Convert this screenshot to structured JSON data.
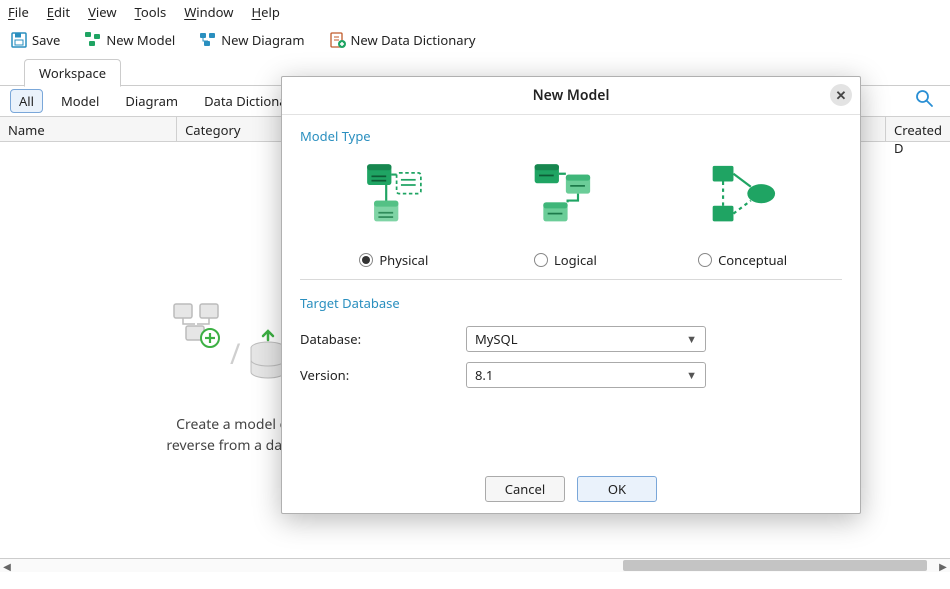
{
  "menubar": {
    "file": "File",
    "edit": "Edit",
    "view": "View",
    "tools": "Tools",
    "window": "Window",
    "help": "Help"
  },
  "toolbar": {
    "save": "Save",
    "new_model": "New Model",
    "new_diagram": "New Diagram",
    "new_data_dictionary": "New Data Dictionary"
  },
  "tab": {
    "workspace": "Workspace"
  },
  "filters": {
    "all": "All",
    "model": "Model",
    "diagram": "Diagram",
    "data_dictionary": "Data Dictionary"
  },
  "grid": {
    "col_name": "Name",
    "col_category": "Category",
    "col_created": "Created D"
  },
  "placeholder": {
    "line1": "Create a model or",
    "line2": "reverse from a datab"
  },
  "dialog": {
    "title": "New Model",
    "section_model_type": "Model Type",
    "opt_physical": "Physical",
    "opt_logical": "Logical",
    "opt_conceptual": "Conceptual",
    "section_target_db": "Target Database",
    "lbl_database": "Database:",
    "lbl_version": "Version:",
    "val_database": "MySQL",
    "val_version": "8.1",
    "btn_cancel": "Cancel",
    "btn_ok": "OK"
  }
}
